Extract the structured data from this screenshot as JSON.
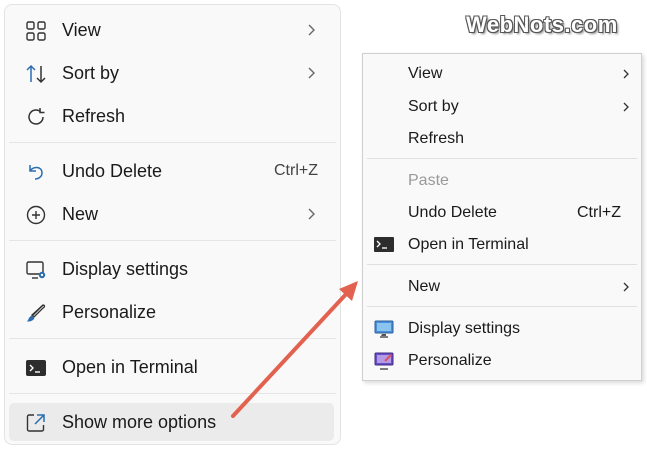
{
  "brand": {
    "logo_text": "WebNots.com"
  },
  "left_menu": {
    "view": "View",
    "sort_by": "Sort by",
    "refresh": "Refresh",
    "undo_delete": "Undo Delete",
    "undo_shortcut": "Ctrl+Z",
    "new": "New",
    "display_settings": "Display settings",
    "personalize": "Personalize",
    "open_terminal": "Open in Terminal",
    "show_more": "Show more options"
  },
  "right_menu": {
    "view": "View",
    "sort_by": "Sort by",
    "refresh": "Refresh",
    "paste": "Paste",
    "undo_delete": "Undo Delete",
    "undo_shortcut": "Ctrl+Z",
    "open_terminal": "Open in Terminal",
    "new": "New",
    "display_settings": "Display settings",
    "personalize": "Personalize"
  },
  "colors": {
    "arrow": "#e2624f",
    "accent_blue": "#2b6cb0",
    "highlight": "#ebebeb"
  }
}
